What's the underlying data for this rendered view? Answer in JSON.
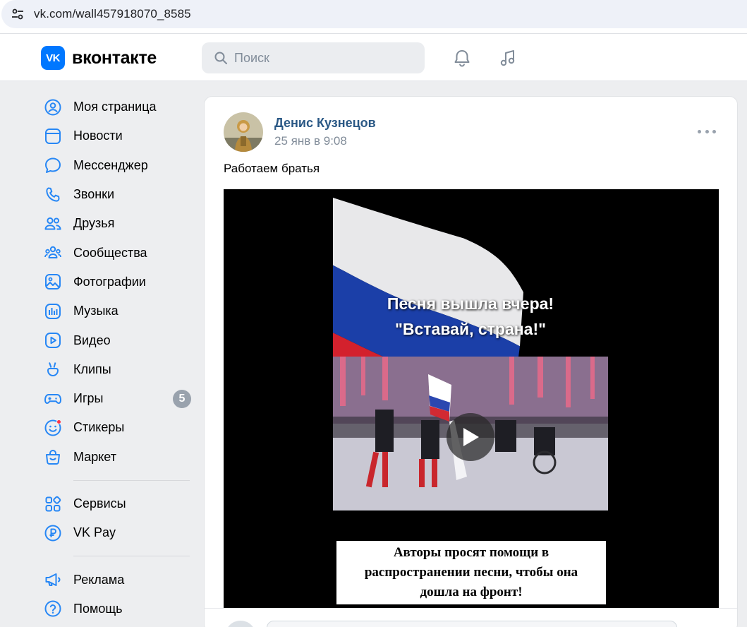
{
  "browser": {
    "url": "vk.com/wall457918070_8585",
    "site_info_icon": "tune-icon"
  },
  "header": {
    "logo_mark": "VK",
    "logo_text": "вконтакте",
    "search_placeholder": "Поиск",
    "icons": [
      "bell-icon",
      "music-note-icon"
    ],
    "accent_color": "#0077ff"
  },
  "sidebar": {
    "items": [
      {
        "label": "Моя страница",
        "icon": "user-circle-icon"
      },
      {
        "label": "Новости",
        "icon": "newsfeed-icon"
      },
      {
        "label": "Мессенджер",
        "icon": "message-icon"
      },
      {
        "label": "Звонки",
        "icon": "phone-icon"
      },
      {
        "label": "Друзья",
        "icon": "users-icon"
      },
      {
        "label": "Сообщества",
        "icon": "communities-icon"
      },
      {
        "label": "Фотографии",
        "icon": "photo-icon"
      },
      {
        "label": "Музыка",
        "icon": "music-icon"
      },
      {
        "label": "Видео",
        "icon": "video-icon"
      },
      {
        "label": "Клипы",
        "icon": "clips-icon"
      },
      {
        "label": "Игры",
        "icon": "gamepad-icon",
        "badge": "5"
      },
      {
        "label": "Стикеры",
        "icon": "sticker-icon",
        "has_dot": true
      },
      {
        "label": "Маркет",
        "icon": "market-icon"
      }
    ],
    "items2": [
      {
        "label": "Сервисы",
        "icon": "services-icon"
      },
      {
        "label": "VK Pay",
        "icon": "vkpay-icon"
      }
    ],
    "items3": [
      {
        "label": "Реклама",
        "icon": "megaphone-icon"
      },
      {
        "label": "Помощь",
        "icon": "help-icon"
      }
    ]
  },
  "post": {
    "author": "Денис Кузнецов",
    "time": "25 янв в 9:08",
    "text": "Работаем братья",
    "video": {
      "title_line1": "Песня вышла вчера!",
      "title_line2": "\"Вставай, страна!\"",
      "caption_line1": "Авторы просят помощи в",
      "caption_line2": "распространении песни, чтобы она",
      "caption_line3": "дошла на фронт!"
    },
    "author_color": "#2a5885"
  }
}
